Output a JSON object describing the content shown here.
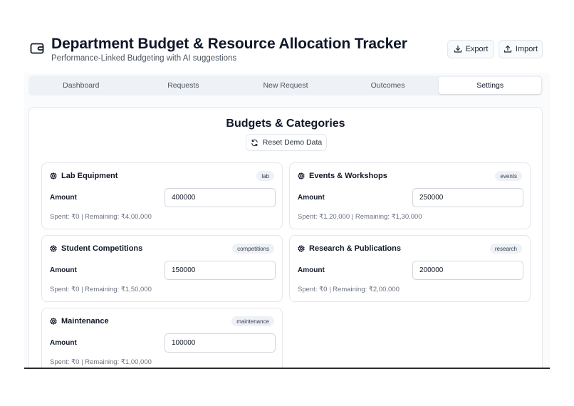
{
  "header": {
    "title": "Department Budget & Resource Allocation Tracker",
    "subtitle": "Performance-Linked Budgeting with AI suggestions",
    "logo_icon": "wallet-icon",
    "export_label": "Export",
    "export_icon": "download-icon",
    "import_label": "Import",
    "import_icon": "upload-icon"
  },
  "tabs": [
    {
      "label": "Dashboard",
      "active": false
    },
    {
      "label": "Requests",
      "active": false
    },
    {
      "label": "New Request",
      "active": false
    },
    {
      "label": "Outcomes",
      "active": false
    },
    {
      "label": "Settings",
      "active": true
    }
  ],
  "settings": {
    "section_title": "Budgets & Categories",
    "reset_label": "Reset Demo Data",
    "reset_icon": "refresh-icon",
    "amount_label": "Amount",
    "category_icon": "gear-icon",
    "categories": [
      {
        "name": "Lab Equipment",
        "tag": "lab",
        "amount": "400000",
        "meta": "Spent: ₹0 | Remaining: ₹4,00,000"
      },
      {
        "name": "Events & Workshops",
        "tag": "events",
        "amount": "250000",
        "meta": "Spent: ₹1,20,000 | Remaining: ₹1,30,000"
      },
      {
        "name": "Student Competitions",
        "tag": "competitions",
        "amount": "150000",
        "meta": "Spent: ₹0 | Remaining: ₹1,50,000"
      },
      {
        "name": "Research & Publications",
        "tag": "research",
        "amount": "200000",
        "meta": "Spent: ₹0 | Remaining: ₹2,00,000"
      },
      {
        "name": "Maintenance",
        "tag": "maintenance",
        "amount": "100000",
        "meta": "Spent: ₹0 | Remaining: ₹1,00,000"
      }
    ]
  },
  "colors": {
    "tab_bar_bg": "#eef1f5",
    "card_border": "#e5e7eb",
    "muted_text": "#6b7280",
    "title_text": "#0f172a"
  }
}
